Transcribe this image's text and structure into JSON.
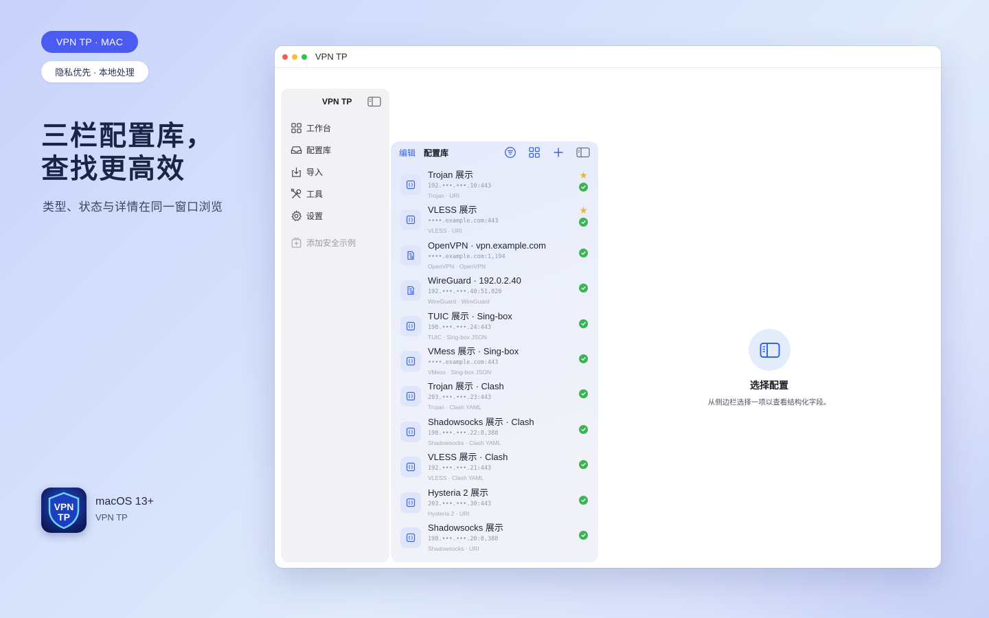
{
  "badges": {
    "primary": "VPN TP ·  MAC",
    "secondary": "隐私优先 ·  本地处理"
  },
  "headline": {
    "line1": "三栏配置库，",
    "line2": "查找更高效"
  },
  "subline": "类型、状态与详情在同一窗口浏览",
  "app": {
    "icon_text_top": "VPN",
    "icon_text_bottom": "TP",
    "name": "macOS 13+",
    "sub": "VPN TP"
  },
  "window": {
    "title": "VPN TP"
  },
  "sidebar": {
    "title": "VPN TP",
    "items": [
      {
        "label": "工作台",
        "icon": "grid-icon"
      },
      {
        "label": "配置库",
        "icon": "tray-icon"
      },
      {
        "label": "导入",
        "icon": "import-icon"
      },
      {
        "label": "工具",
        "icon": "tools-icon"
      },
      {
        "label": "设置",
        "icon": "gear-icon"
      }
    ],
    "extra": {
      "label": "添加安全示例",
      "icon": "add-doc-icon"
    }
  },
  "list": {
    "edit_label": "编辑",
    "title": "配置库",
    "rows": [
      {
        "name": "Trojan 展示",
        "addr": "192.•••.•••.10:443",
        "meta": "Trojan  ·  URI",
        "star": true,
        "ok": true,
        "icon": "braces-doc-icon"
      },
      {
        "name": "VLESS 展示",
        "addr": "••••.example.com:443",
        "meta": "VLESS  ·  URI",
        "star": true,
        "ok": true,
        "icon": "braces-doc-icon"
      },
      {
        "name": "OpenVPN · vpn.example.com",
        "addr": "••••.example.com:1,194",
        "meta": "OpenVPN  ·  OpenVPN",
        "star": false,
        "ok": true,
        "icon": "doc-search-icon"
      },
      {
        "name": "WireGuard · 192.0.2.40",
        "addr": "192.•••.•••.40:51,820",
        "meta": "WireGuard  ·  WireGuard",
        "star": false,
        "ok": true,
        "icon": "doc-search-icon"
      },
      {
        "name": "TUIC 展示 · Sing-box",
        "addr": "198.•••.•••.24:443",
        "meta": "TUIC  ·  Sing-box JSON",
        "star": false,
        "ok": true,
        "icon": "braces-doc-icon"
      },
      {
        "name": "VMess 展示 · Sing-box",
        "addr": "••••.example.com:443",
        "meta": "VMess  ·  Sing-box JSON",
        "star": false,
        "ok": true,
        "icon": "braces-doc-icon"
      },
      {
        "name": "Trojan 展示 · Clash",
        "addr": "203.•••.•••.23:443",
        "meta": "Trojan  ·  Clash YAML",
        "star": false,
        "ok": true,
        "icon": "braces-doc-icon"
      },
      {
        "name": "Shadowsocks 展示 · Clash",
        "addr": "198.•••.•••.22:8,388",
        "meta": "Shadowsocks  ·  Clash YAML",
        "star": false,
        "ok": true,
        "icon": "braces-doc-icon"
      },
      {
        "name": "VLESS 展示 · Clash",
        "addr": "192.•••.•••.21:443",
        "meta": "VLESS  ·  Clash YAML",
        "star": false,
        "ok": true,
        "icon": "braces-doc-icon"
      },
      {
        "name": "Hysteria 2 展示",
        "addr": "203.•••.•••.30:443",
        "meta": "Hysteria 2  ·  URI",
        "star": false,
        "ok": true,
        "icon": "braces-doc-icon"
      },
      {
        "name": "Shadowsocks 展示",
        "addr": "198.•••.•••.20:8,388",
        "meta": "Shadowsocks  ·  URI",
        "star": false,
        "ok": true,
        "icon": "braces-doc-icon"
      }
    ]
  },
  "detail": {
    "title": "选择配置",
    "subtitle": "从侧边栏选择一项以查看结构化字段。",
    "icon": "sidebar-icon"
  },
  "colors": {
    "accent": "#4a5cf0",
    "link": "#3b63e0",
    "ok": "#3bb456",
    "star": "#f0b52a"
  }
}
